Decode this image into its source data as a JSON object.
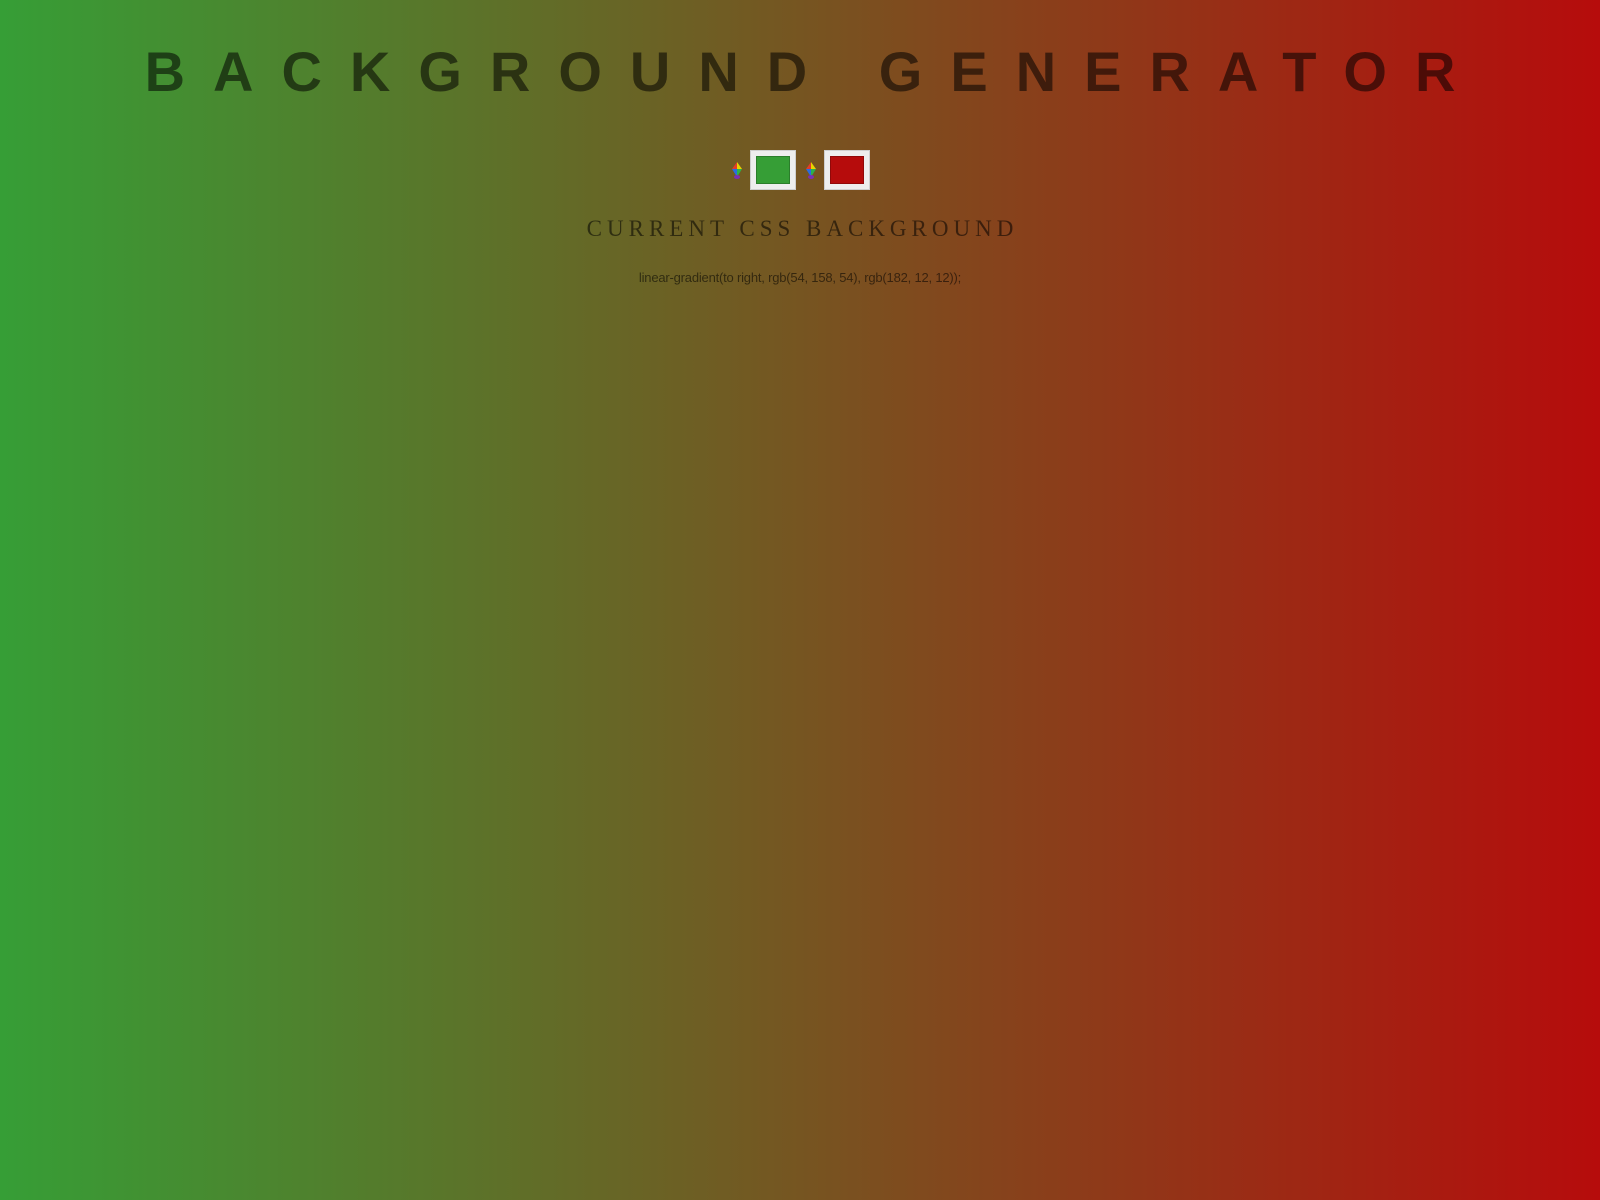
{
  "header": {
    "title": "BACKGROUND GENERATOR"
  },
  "pickers": [
    {
      "name": "color1",
      "value_hex": "#369e36",
      "icon": "color-wheel-icon"
    },
    {
      "name": "color2",
      "value_hex": "#b60c0c",
      "icon": "color-wheel-icon"
    }
  ],
  "section": {
    "subtitle": "CURRENT CSS BACKGROUND",
    "css_value": "linear-gradient(to right, rgb(54, 158, 54), rgb(182, 12, 12));"
  },
  "colors": {
    "gradient_start": "#369e36",
    "gradient_end": "#b60c0c",
    "text": "rgba(0,0,0,0.55)"
  }
}
